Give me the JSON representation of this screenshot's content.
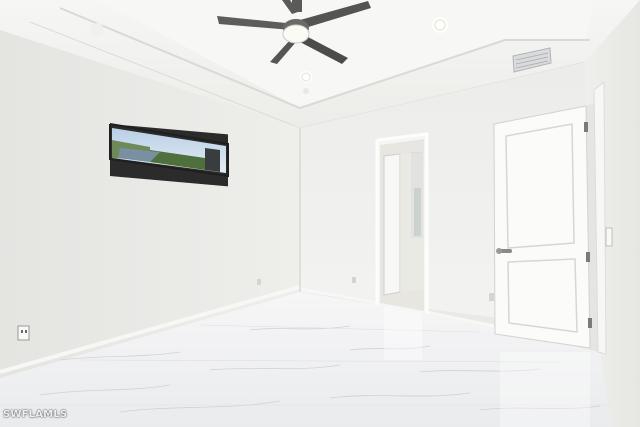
{
  "photo": {
    "subject": "empty-bedroom",
    "watermark": "SWFLAMLS"
  },
  "palette": {
    "wall_left": "#ededea",
    "wall_back": "#f0f0ed",
    "wall_right": "#f2f2ef",
    "ceiling": "#f3f3f1",
    "floor": "#f1f2f3",
    "door": "#fbfbf9"
  },
  "icons": {
    "fan": "ceiling-fan-icon",
    "vent": "air-vent-icon",
    "outlet": "electrical-outlet-icon"
  }
}
